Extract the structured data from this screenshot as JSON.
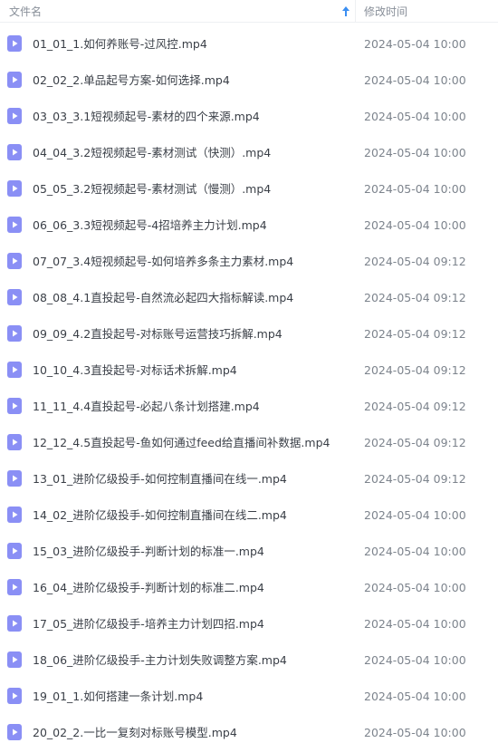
{
  "header": {
    "name_label": "文件名",
    "date_label": "修改时间",
    "sort_icon": "arrow-up-icon"
  },
  "colors": {
    "icon_bg": "#8a8ff5",
    "sort_arrow": "#3b8ff2"
  },
  "files": [
    {
      "name": "01_01_1.如何养账号-过风控.mp4",
      "date": "2024-05-04 10:00"
    },
    {
      "name": "02_02_2.单品起号方案-如何选择.mp4",
      "date": "2024-05-04 10:00"
    },
    {
      "name": "03_03_3.1短视频起号-素材的四个来源.mp4",
      "date": "2024-05-04 10:00"
    },
    {
      "name": "04_04_3.2短视频起号-素材测试（快测）.mp4",
      "date": "2024-05-04 10:00"
    },
    {
      "name": "05_05_3.2短视频起号-素材测试（慢测）.mp4",
      "date": "2024-05-04 10:00"
    },
    {
      "name": "06_06_3.3短视频起号-4招培养主力计划.mp4",
      "date": "2024-05-04 10:00"
    },
    {
      "name": "07_07_3.4短视频起号-如何培养多条主力素材.mp4",
      "date": "2024-05-04 09:12"
    },
    {
      "name": "08_08_4.1直投起号-自然流必起四大指标解读.mp4",
      "date": "2024-05-04 09:12"
    },
    {
      "name": "09_09_4.2直投起号-对标账号运营技巧拆解.mp4",
      "date": "2024-05-04 09:12"
    },
    {
      "name": "10_10_4.3直投起号-对标话术拆解.mp4",
      "date": "2024-05-04 09:12"
    },
    {
      "name": "11_11_4.4直投起号-必起八条计划搭建.mp4",
      "date": "2024-05-04 09:12"
    },
    {
      "name": "12_12_4.5直投起号-鱼如何通过feed给直播间补数据.mp4",
      "date": "2024-05-04 09:12"
    },
    {
      "name": "13_01_进阶亿级投手-如何控制直播间在线一.mp4",
      "date": "2024-05-04 09:12"
    },
    {
      "name": "14_02_进阶亿级投手-如何控制直播间在线二.mp4",
      "date": "2024-05-04 10:00"
    },
    {
      "name": "15_03_进阶亿级投手-判断计划的标准一.mp4",
      "date": "2024-05-04 10:00"
    },
    {
      "name": "16_04_进阶亿级投手-判断计划的标准二.mp4",
      "date": "2024-05-04 10:00"
    },
    {
      "name": "17_05_进阶亿级投手-培养主力计划四招.mp4",
      "date": "2024-05-04 10:00"
    },
    {
      "name": "18_06_进阶亿级投手-主力计划失败调整方案.mp4",
      "date": "2024-05-04 10:00"
    },
    {
      "name": "19_01_1.如何搭建一条计划.mp4",
      "date": "2024-05-04 10:00"
    },
    {
      "name": "20_02_2.一比一复刻对标账号模型.mp4",
      "date": "2024-05-04 10:00"
    }
  ]
}
